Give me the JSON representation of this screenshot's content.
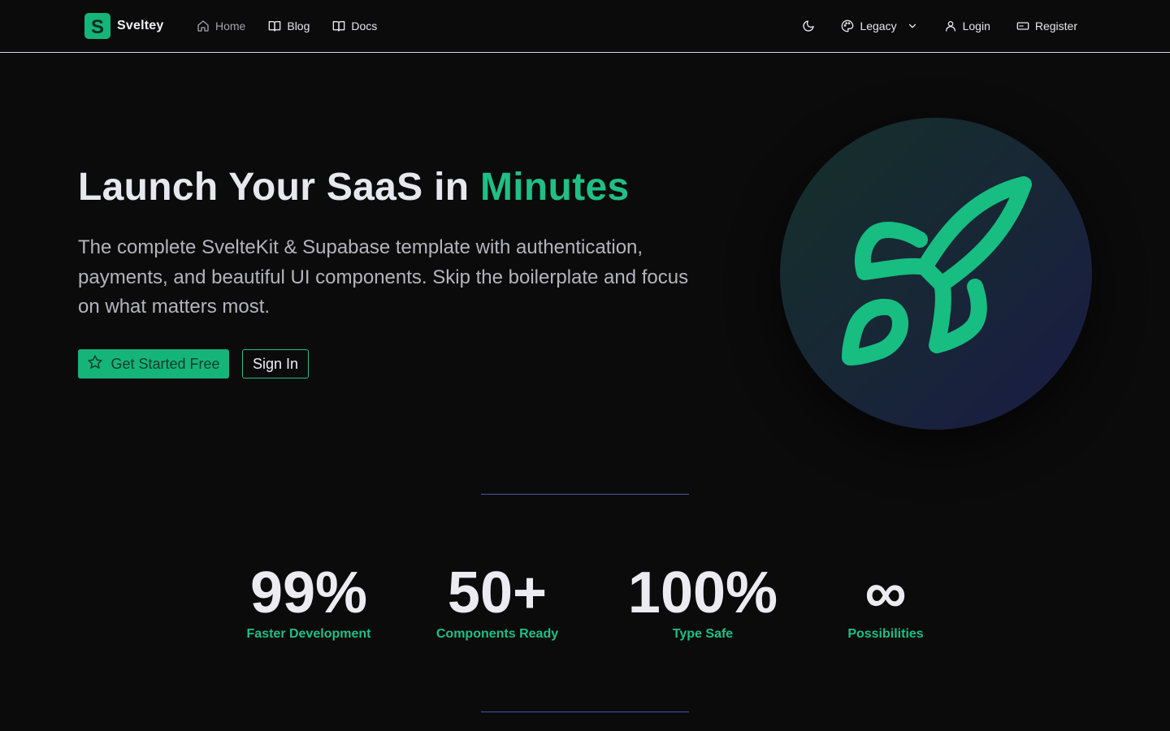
{
  "brand": {
    "name": "Sveltey",
    "logo_letter": "S",
    "logo_color": "#15b57a"
  },
  "nav": {
    "left": [
      {
        "label": "Home",
        "icon": "home-icon",
        "active": true
      },
      {
        "label": "Blog",
        "icon": "book-icon"
      },
      {
        "label": "Docs",
        "icon": "book-icon"
      }
    ],
    "theme_toggle_icon": "moon-icon",
    "theme": {
      "label": "Legacy",
      "icon": "palette-icon",
      "dropdown_icon": "chevron-down-icon"
    },
    "login": {
      "label": "Login",
      "icon": "user-icon"
    },
    "register": {
      "label": "Register",
      "icon": "card-icon"
    }
  },
  "hero": {
    "title_main": "Launch Your SaaS in ",
    "title_accent": "Minutes",
    "subtitle": "The complete SvelteKit & Supabase template with authentication, payments, and beautiful UI components. Skip the boilerplate and focus on what matters most.",
    "primary_button": {
      "label": "Get Started Free",
      "icon": "star-icon"
    },
    "secondary_button": {
      "label": "Sign In"
    },
    "illustration_icon": "rocket-icon"
  },
  "stats": [
    {
      "value": "99%",
      "label": "Faster Development"
    },
    {
      "value": "50+",
      "label": "Components Ready"
    },
    {
      "value": "100%",
      "label": "Type Safe"
    },
    {
      "value": "∞",
      "label": "Possibilities"
    }
  ],
  "colors": {
    "accent": "#1fbf85",
    "button_primary": "#15b57a",
    "background": "#0b0b0c",
    "divider": "#4a55a8"
  }
}
